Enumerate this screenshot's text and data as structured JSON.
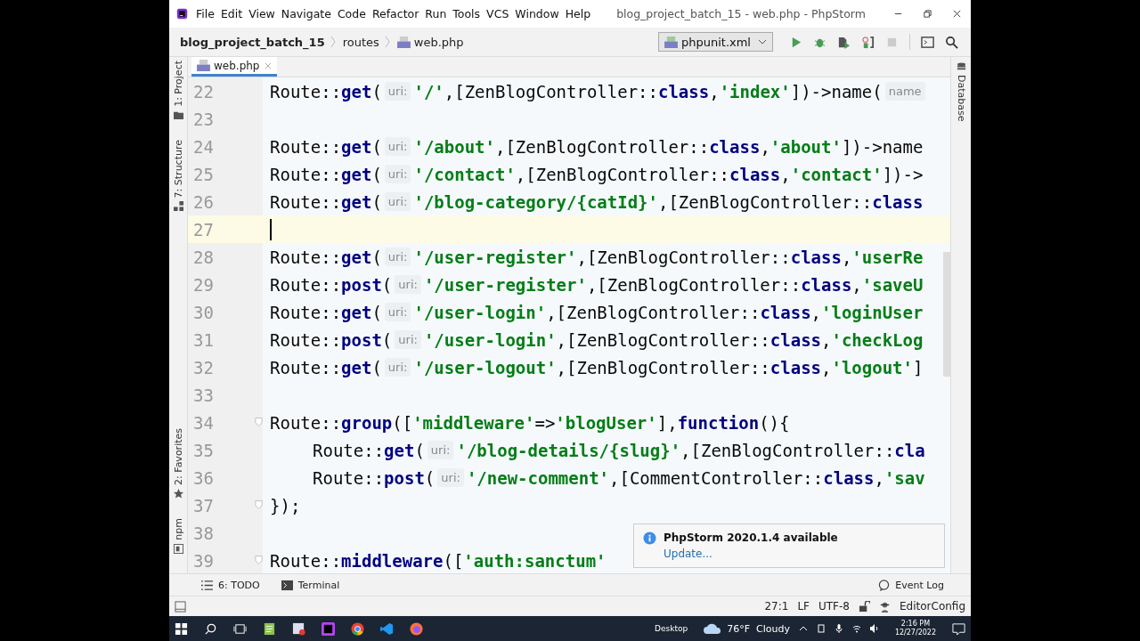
{
  "window": {
    "title": "blog_project_batch_15 - web.php - PhpStorm"
  },
  "menu": [
    "File",
    "Edit",
    "View",
    "Navigate",
    "Code",
    "Refactor",
    "Run",
    "Tools",
    "VCS",
    "Window",
    "Help"
  ],
  "breadcrumbs": [
    "blog_project_batch_15",
    "routes",
    "web.php"
  ],
  "run_config": "phpunit.xml",
  "editor_tab": {
    "label": "web.php",
    "selected": true
  },
  "left_tool_tabs": [
    "1: Project",
    "7: Structure",
    "2: Favorites",
    "npm"
  ],
  "right_tool_tabs": [
    "Database"
  ],
  "lines": [
    {
      "number": "22",
      "current": false,
      "fold": false,
      "tokens": [
        {
          "kind": "code",
          "text": "Route::"
        },
        {
          "kind": "keyword",
          "text": "get"
        },
        {
          "kind": "code",
          "text": "("
        },
        {
          "kind": "hint",
          "text": "uri:"
        },
        {
          "kind": "string",
          "text": "'/'"
        },
        {
          "kind": "code",
          "text": ",[ZenBlogController::"
        },
        {
          "kind": "keyword",
          "text": "class"
        },
        {
          "kind": "code",
          "text": ","
        },
        {
          "kind": "string",
          "text": "'index'"
        },
        {
          "kind": "code",
          "text": "])->name("
        },
        {
          "kind": "hint",
          "text": "name"
        }
      ]
    },
    {
      "number": "23",
      "current": false,
      "fold": false
    },
    {
      "number": "24",
      "current": false,
      "fold": false,
      "tokens": [
        {
          "kind": "code",
          "text": "Route::"
        },
        {
          "kind": "keyword",
          "text": "get"
        },
        {
          "kind": "code",
          "text": "("
        },
        {
          "kind": "hint",
          "text": "uri:"
        },
        {
          "kind": "string",
          "text": "'/about'"
        },
        {
          "kind": "code",
          "text": ",[ZenBlogController::"
        },
        {
          "kind": "keyword",
          "text": "class"
        },
        {
          "kind": "code",
          "text": ","
        },
        {
          "kind": "string",
          "text": "'about'"
        },
        {
          "kind": "code",
          "text": "])->name"
        }
      ]
    },
    {
      "number": "25",
      "current": false,
      "fold": false,
      "tokens": [
        {
          "kind": "code",
          "text": "Route::"
        },
        {
          "kind": "keyword",
          "text": "get"
        },
        {
          "kind": "code",
          "text": "("
        },
        {
          "kind": "hint",
          "text": "uri:"
        },
        {
          "kind": "string",
          "text": "'/contact'"
        },
        {
          "kind": "code",
          "text": ",[ZenBlogController::"
        },
        {
          "kind": "keyword",
          "text": "class"
        },
        {
          "kind": "code",
          "text": ","
        },
        {
          "kind": "string",
          "text": "'contact'"
        },
        {
          "kind": "code",
          "text": "])->"
        }
      ]
    },
    {
      "number": "26",
      "current": false,
      "fold": false,
      "tokens": [
        {
          "kind": "code",
          "text": "Route::"
        },
        {
          "kind": "keyword",
          "text": "get"
        },
        {
          "kind": "code",
          "text": "("
        },
        {
          "kind": "hint",
          "text": "uri:"
        },
        {
          "kind": "string",
          "text": "'/blog-category/{catId}'"
        },
        {
          "kind": "code",
          "text": ",[ZenBlogController::"
        },
        {
          "kind": "keyword",
          "text": "class"
        }
      ]
    },
    {
      "number": "27",
      "current": true,
      "fold": false
    },
    {
      "number": "28",
      "current": false,
      "fold": false,
      "tokens": [
        {
          "kind": "code",
          "text": "Route::"
        },
        {
          "kind": "keyword",
          "text": "get"
        },
        {
          "kind": "code",
          "text": "("
        },
        {
          "kind": "hint",
          "text": "uri:"
        },
        {
          "kind": "string",
          "text": "'/user-register'"
        },
        {
          "kind": "code",
          "text": ",[ZenBlogController::"
        },
        {
          "kind": "keyword",
          "text": "class"
        },
        {
          "kind": "code",
          "text": ","
        },
        {
          "kind": "string",
          "text": "'userRe"
        }
      ]
    },
    {
      "number": "29",
      "current": false,
      "fold": false,
      "tokens": [
        {
          "kind": "code",
          "text": "Route::"
        },
        {
          "kind": "keyword",
          "text": "post"
        },
        {
          "kind": "code",
          "text": "("
        },
        {
          "kind": "hint",
          "text": "uri:"
        },
        {
          "kind": "string",
          "text": "'/user-register'"
        },
        {
          "kind": "code",
          "text": ",[ZenBlogController::"
        },
        {
          "kind": "keyword",
          "text": "class"
        },
        {
          "kind": "code",
          "text": ","
        },
        {
          "kind": "string",
          "text": "'saveU"
        }
      ]
    },
    {
      "number": "30",
      "current": false,
      "fold": false,
      "tokens": [
        {
          "kind": "code",
          "text": "Route::"
        },
        {
          "kind": "keyword",
          "text": "get"
        },
        {
          "kind": "code",
          "text": "("
        },
        {
          "kind": "hint",
          "text": "uri:"
        },
        {
          "kind": "string",
          "text": "'/user-login'"
        },
        {
          "kind": "code",
          "text": ",[ZenBlogController::"
        },
        {
          "kind": "keyword",
          "text": "class"
        },
        {
          "kind": "code",
          "text": ","
        },
        {
          "kind": "string",
          "text": "'loginUser"
        }
      ]
    },
    {
      "number": "31",
      "current": false,
      "fold": false,
      "tokens": [
        {
          "kind": "code",
          "text": "Route::"
        },
        {
          "kind": "keyword",
          "text": "post"
        },
        {
          "kind": "code",
          "text": "("
        },
        {
          "kind": "hint",
          "text": "uri:"
        },
        {
          "kind": "string",
          "text": "'/user-login'"
        },
        {
          "kind": "code",
          "text": ",[ZenBlogController::"
        },
        {
          "kind": "keyword",
          "text": "class"
        },
        {
          "kind": "code",
          "text": ","
        },
        {
          "kind": "string",
          "text": "'checkLog"
        }
      ]
    },
    {
      "number": "32",
      "current": false,
      "fold": false,
      "tokens": [
        {
          "kind": "code",
          "text": "Route::"
        },
        {
          "kind": "keyword",
          "text": "get"
        },
        {
          "kind": "code",
          "text": "("
        },
        {
          "kind": "hint",
          "text": "uri:"
        },
        {
          "kind": "string",
          "text": "'/user-logout'"
        },
        {
          "kind": "code",
          "text": ",[ZenBlogController::"
        },
        {
          "kind": "keyword",
          "text": "class"
        },
        {
          "kind": "code",
          "text": ","
        },
        {
          "kind": "string",
          "text": "'logout'"
        },
        {
          "kind": "code",
          "text": "]"
        }
      ]
    },
    {
      "number": "33",
      "current": false,
      "fold": false
    },
    {
      "number": "34",
      "current": false,
      "fold": true,
      "tokens": [
        {
          "kind": "code",
          "text": "Route::"
        },
        {
          "kind": "keyword",
          "text": "group"
        },
        {
          "kind": "code",
          "text": "(["
        },
        {
          "kind": "string",
          "text": "'middleware'"
        },
        {
          "kind": "code",
          "text": "=>"
        },
        {
          "kind": "string",
          "text": "'blogUser'"
        },
        {
          "kind": "code",
          "text": "],"
        },
        {
          "kind": "keyword",
          "text": "function"
        },
        {
          "kind": "code",
          "text": "(){"
        }
      ],
      "children": [
        {
          "number": "35",
          "current": false,
          "fold": false,
          "tokens": [
            {
              "kind": "code",
              "text": "Route::"
            },
            {
              "kind": "keyword",
              "text": "get"
            },
            {
              "kind": "code",
              "text": "("
            },
            {
              "kind": "hint",
              "text": "uri:"
            },
            {
              "kind": "string",
              "text": "'/blog-details/{slug}'"
            },
            {
              "kind": "code",
              "text": ",[ZenBlogController::"
            },
            {
              "kind": "keyword",
              "text": "cla"
            }
          ]
        },
        {
          "number": "36",
          "current": false,
          "fold": false,
          "tokens": [
            {
              "kind": "code",
              "text": "Route::"
            },
            {
              "kind": "keyword",
              "text": "post"
            },
            {
              "kind": "code",
              "text": "("
            },
            {
              "kind": "hint",
              "text": "uri:"
            },
            {
              "kind": "string",
              "text": "'/new-comment'"
            },
            {
              "kind": "code",
              "text": ",[CommentController::"
            },
            {
              "kind": "keyword",
              "text": "class"
            },
            {
              "kind": "code",
              "text": ","
            },
            {
              "kind": "string",
              "text": "'sav"
            }
          ]
        }
      ]
    },
    {
      "number": "37",
      "current": false,
      "fold": true,
      "tokens": [
        {
          "kind": "code",
          "text": "});"
        }
      ]
    },
    {
      "number": "38",
      "current": false,
      "fold": false
    },
    {
      "number": "39",
      "current": false,
      "fold": true,
      "tokens": [
        {
          "kind": "code",
          "text": "Route::"
        },
        {
          "kind": "keyword",
          "text": "middleware"
        },
        {
          "kind": "code",
          "text": "(["
        },
        {
          "kind": "string",
          "text": "'auth:sanctum'"
        }
      ]
    }
  ],
  "notification": {
    "title": "PhpStorm 2020.1.4 available",
    "link": "Update..."
  },
  "bottom_tool_tabs": [
    "6: TODO",
    "Terminal"
  ],
  "event_log": "Event Log",
  "status_bar": [
    "27:1",
    "LF",
    "UTF-8"
  ],
  "editor_config": "EditorConfig",
  "taskbar": {
    "desktop": "Desktop",
    "weather": "76°F  Cloudy",
    "time": "2:16 PM",
    "date": "12/27/2022"
  }
}
